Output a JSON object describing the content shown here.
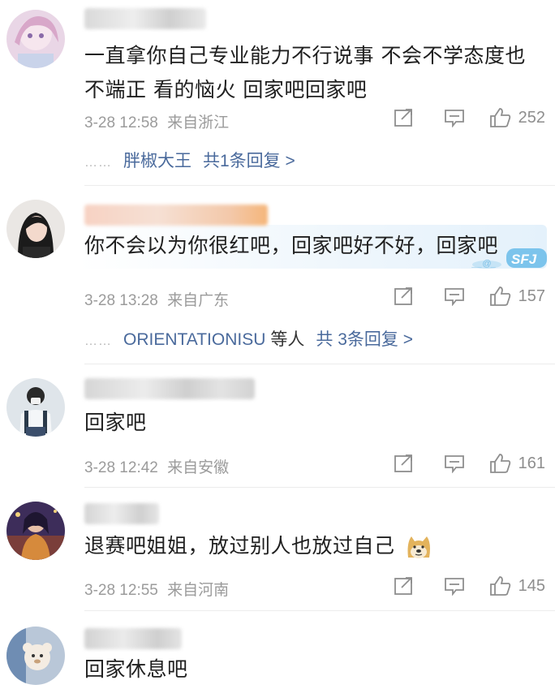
{
  "comments": [
    {
      "text_lines": [
        "一直拿你自己专业能力不行说事 不会不学态度也",
        "不端正 看的恼火 回家吧回家吧"
      ],
      "time": "3-28 12:58",
      "location": "来自浙江",
      "likes": "252",
      "replies": {
        "dots": "……",
        "who": "胖椒大王",
        "mid": "",
        "count": "共1条回复 >"
      }
    },
    {
      "text_lines": [
        "你不会以为你很红吧，回家吧好不好，回家吧"
      ],
      "time": "3-28 13:28",
      "location": "来自广东",
      "likes": "157",
      "badge": "SFJ",
      "replies": {
        "dots": "……",
        "who": "ORIENTATIONISU",
        "mid": "等人",
        "count": "共 3条回复 >"
      }
    },
    {
      "text_lines": [
        "回家吧"
      ],
      "time": "3-28 12:42",
      "location": "来自安徽",
      "likes": "161"
    },
    {
      "text_lines": [
        "退赛吧姐姐，放过别人也放过自己"
      ],
      "emoji": "doge-icon",
      "time": "3-28 12:55",
      "location": "来自河南",
      "likes": "145"
    },
    {
      "text_lines": [
        "回家休息吧"
      ]
    }
  ],
  "colors": {
    "link": "#4a6a9c",
    "meta": "#9b9b9b",
    "text": "#1f1f1f"
  }
}
